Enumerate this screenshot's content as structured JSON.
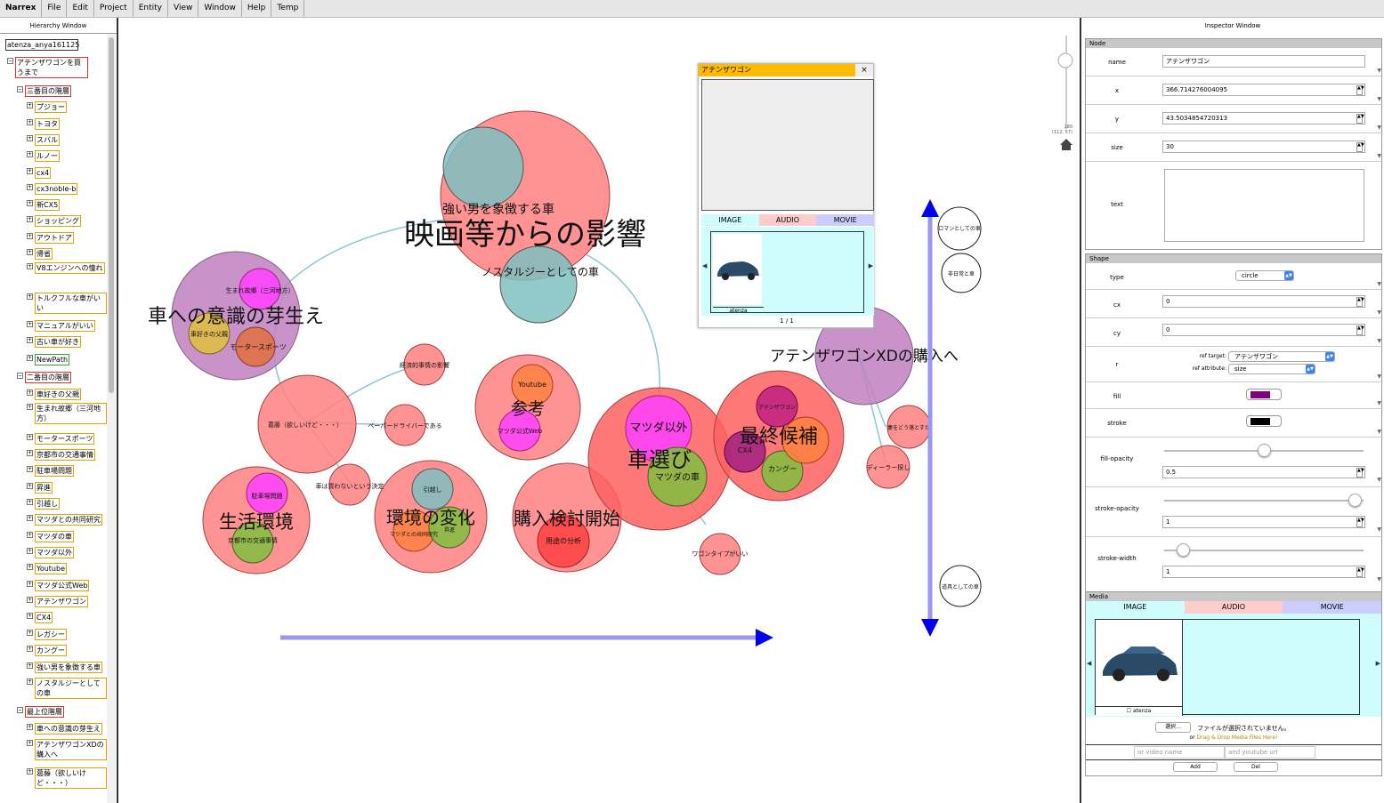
{
  "menu": {
    "app": "Narrex",
    "items": [
      "File",
      "Edit",
      "Project",
      "Entity",
      "View",
      "Window",
      "Help",
      "Temp"
    ]
  },
  "hierarchy": {
    "title": "Hierarchy Window",
    "root": "atenza_anya161125",
    "items": [
      {
        "label": "アテンザワゴンを買うまで",
        "level": 1,
        "style": "red"
      },
      {
        "label": "三番目の階層",
        "level": 2,
        "style": "red"
      },
      {
        "label": "プジョー",
        "level": 3,
        "style": ""
      },
      {
        "label": "トヨタ",
        "level": 3,
        "style": ""
      },
      {
        "label": "スバル",
        "level": 3,
        "style": ""
      },
      {
        "label": "ルノー",
        "level": 3,
        "style": ""
      },
      {
        "label": "cx4",
        "level": 3,
        "style": ""
      },
      {
        "label": "cx3noble-b",
        "level": 3,
        "style": ""
      },
      {
        "label": "新CX5",
        "level": 3,
        "style": ""
      },
      {
        "label": "ショッピング",
        "level": 3,
        "style": ""
      },
      {
        "label": "アウトドア",
        "level": 3,
        "style": ""
      },
      {
        "label": "帰省",
        "level": 3,
        "style": ""
      },
      {
        "label": "V8エンジンへの憧れ",
        "level": 3,
        "style": ""
      },
      {
        "label": "トルクフルな車がいい",
        "level": 3,
        "style": ""
      },
      {
        "label": "マニュアルがいい",
        "level": 3,
        "style": ""
      },
      {
        "label": "古い車が好き",
        "level": 3,
        "style": ""
      },
      {
        "label": "NewPath",
        "level": 3,
        "style": "green"
      },
      {
        "label": "二番目の階層",
        "level": 2,
        "style": "red"
      },
      {
        "label": "車好きの父親",
        "level": 3,
        "style": ""
      },
      {
        "label": "生まれ故郷（三河地方）",
        "level": 3,
        "style": ""
      },
      {
        "label": "モータースポーツ",
        "level": 3,
        "style": ""
      },
      {
        "label": "京都市の交通事情",
        "level": 3,
        "style": ""
      },
      {
        "label": "駐車場問題",
        "level": 3,
        "style": ""
      },
      {
        "label": "昇進",
        "level": 3,
        "style": ""
      },
      {
        "label": "引越し",
        "level": 3,
        "style": ""
      },
      {
        "label": "マツダとの共同研究",
        "level": 3,
        "style": ""
      },
      {
        "label": "マツダの車",
        "level": 3,
        "style": ""
      },
      {
        "label": "マツダ以外",
        "level": 3,
        "style": ""
      },
      {
        "label": "Youtube",
        "level": 3,
        "style": ""
      },
      {
        "label": "マツダ公式Web",
        "level": 3,
        "style": ""
      },
      {
        "label": "アテンザワゴン",
        "level": 3,
        "style": ""
      },
      {
        "label": "CX4",
        "level": 3,
        "style": ""
      },
      {
        "label": "レガシー",
        "level": 3,
        "style": ""
      },
      {
        "label": "カングー",
        "level": 3,
        "style": ""
      },
      {
        "label": "強い男を象徴する車",
        "level": 3,
        "style": ""
      },
      {
        "label": "ノスタルジーとしての車",
        "level": 3,
        "style": ""
      },
      {
        "label": "最上位階層",
        "level": 2,
        "style": "red"
      },
      {
        "label": "車への意識の芽生え",
        "level": 3,
        "style": ""
      },
      {
        "label": "アテンザワゴンXDの購入へ",
        "level": 3,
        "style": ""
      },
      {
        "label": "葛藤（欲しいけど・・・）",
        "level": 3,
        "style": ""
      }
    ]
  },
  "canvas": {
    "labels": {
      "movie": "映画等からの影響",
      "strong": "強い男を象徴する車",
      "nostalgia": "ノスタルジーとしての車",
      "awareness": "車への意識の芽生え",
      "birthplace": "生まれ故郷（三河地方）",
      "father": "車好きの父親",
      "motorsport": "モータースポーツ",
      "economic": "経済的事情の影響",
      "paper": "ペーパードライバーである",
      "conflict": "葛藤（欲しいけど・・・）",
      "nobuy": "車は買わないという決定",
      "youtube": "Youtube",
      "reference": "参考",
      "mazdaweb": "マツダ公式Web",
      "env": "生活環境",
      "parking": "駐車場問題",
      "kyoto": "京都市の交通事情",
      "change": "環境の変化",
      "moving": "引越し",
      "joint": "マツダとの共同研究",
      "promo": "昇進",
      "start": "購入検討開始",
      "usage": "用途の分析",
      "choice": "車選び",
      "nonmazda": "マツダ以外",
      "mazdacar": "マツダの車",
      "wagon": "ワゴンタイプがいい",
      "final": "最終候補",
      "atenza": "アテンザワゴン",
      "cx4": "CX4",
      "kangoo": "カングー",
      "xd": "アテンザワゴンXDの購入へ",
      "dealer": "ディーラー探し",
      "convince": "妻をどう落とすか",
      "romance": "ロマンとしての車",
      "unusual": "非日常と車",
      "tool": "道具としての車"
    },
    "zoom": {
      "top": "180",
      "bottom": "(112, 57)"
    }
  },
  "popup": {
    "title": "アテンザワゴン",
    "close": "×",
    "tabs": [
      "IMAGE",
      "AUDIO",
      "MOVIE"
    ],
    "caption": "atenza",
    "pager": "1 / 1"
  },
  "inspector": {
    "title": "Inspector Window",
    "node": {
      "header": "Node",
      "name_label": "name",
      "name": "アテンザワゴン",
      "x_label": "x",
      "x": "366.714276004095",
      "y_label": "y",
      "y": "43.5034854720313",
      "size_label": "size",
      "size": "30",
      "text_label": "text"
    },
    "shape": {
      "header": "Shape",
      "type_label": "type",
      "type": "circle",
      "cx_label": "cx",
      "cx": "0",
      "cy_label": "cy",
      "cy": "0",
      "r_label": "r",
      "ref_target_label": "ref target:",
      "ref_target": "アテンザワゴン",
      "ref_attr_label": "ref attribute:",
      "ref_attr": "size",
      "fill_label": "fill",
      "fill_color": "#800080",
      "stroke_label": "stroke",
      "stroke_color": "#000000",
      "fill_opacity_label": "fill-opacity",
      "fill_opacity": "0.5",
      "stroke_opacity_label": "stroke-opacity",
      "stroke_opacity": "1",
      "stroke_width_label": "stroke-width",
      "stroke_width": "1"
    },
    "media": {
      "header": "Media",
      "tabs": [
        "IMAGE",
        "AUDIO",
        "MOVIE"
      ],
      "caption": "atenza",
      "choose": "選択...",
      "no_file": "ファイルが選択されていません。",
      "or": "or",
      "drag": "Drag & Drop Media Files Here!",
      "video_ph": "or video name",
      "youtube_ph": "and youtube url",
      "add": "Add",
      "del": "Del"
    }
  }
}
